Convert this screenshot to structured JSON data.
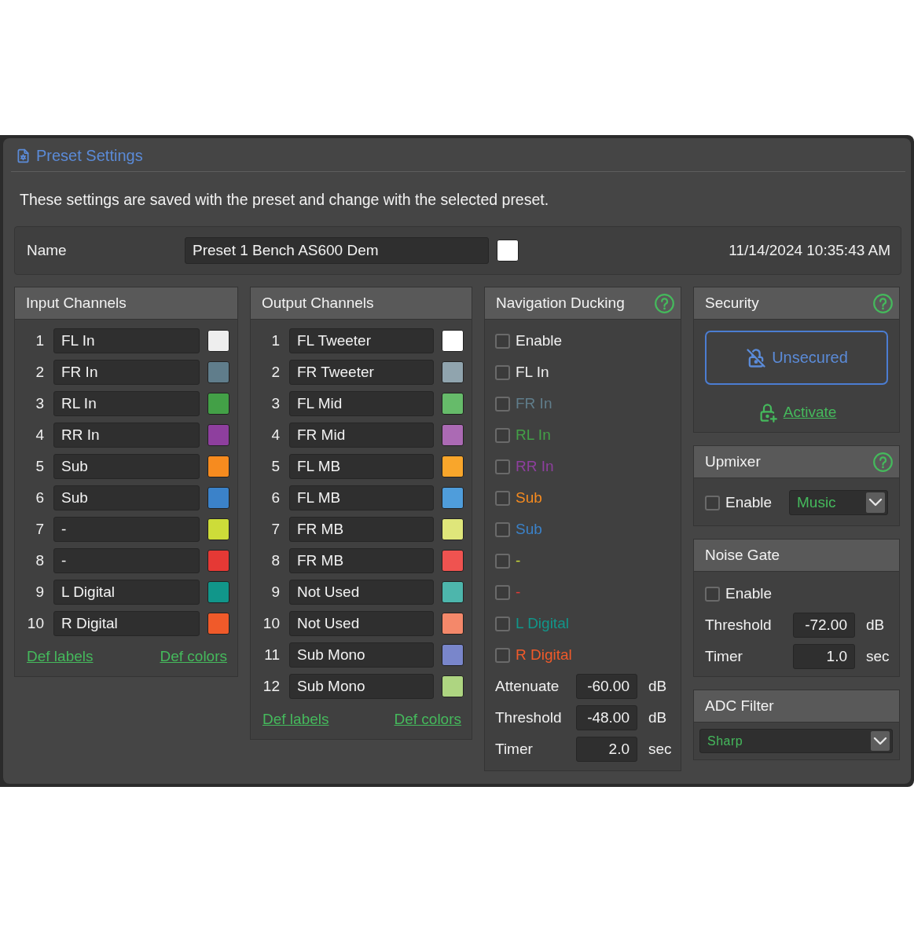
{
  "window": {
    "title": "Preset Settings"
  },
  "description": "These settings are saved with the preset and change with the selected preset.",
  "preset": {
    "label": "Name",
    "value": "Preset 1 Bench AS600 Dem",
    "color": "#ffffff",
    "timestamp": "11/14/2024 10:35:43 AM"
  },
  "input_channels": {
    "title": "Input Channels",
    "channels": [
      {
        "number": "1",
        "name": "FL In",
        "color": "#eeeeee"
      },
      {
        "number": "2",
        "name": "FR In",
        "color": "#607d8b"
      },
      {
        "number": "3",
        "name": "RL In",
        "color": "#43a047"
      },
      {
        "number": "4",
        "name": "RR In",
        "color": "#8e3f9e"
      },
      {
        "number": "5",
        "name": "Sub",
        "color": "#f68b1f"
      },
      {
        "number": "6",
        "name": "Sub",
        "color": "#3b82c9"
      },
      {
        "number": "7",
        "name": "-",
        "color": "#cddc39"
      },
      {
        "number": "8",
        "name": "-",
        "color": "#e53935"
      },
      {
        "number": "9",
        "name": "L Digital",
        "color": "#11968a"
      },
      {
        "number": "10",
        "name": "R Digital",
        "color": "#f05a2a"
      }
    ],
    "links": [
      "Def labels",
      "Def colors"
    ]
  },
  "output_channels": {
    "title": "Output Channels",
    "channels": [
      {
        "number": "1",
        "name": "FL Tweeter",
        "color": "#ffffff"
      },
      {
        "number": "2",
        "name": "FR Tweeter",
        "color": "#90a4ae"
      },
      {
        "number": "3",
        "name": "FL Mid",
        "color": "#66bb6a"
      },
      {
        "number": "4",
        "name": "FR Mid",
        "color": "#ab6ab4"
      },
      {
        "number": "5",
        "name": "FL MB",
        "color": "#f9a62b"
      },
      {
        "number": "6",
        "name": "FL MB",
        "color": "#4f9ddb"
      },
      {
        "number": "7",
        "name": "FR MB",
        "color": "#dfe67a"
      },
      {
        "number": "8",
        "name": "FR MB",
        "color": "#ef5350"
      },
      {
        "number": "9",
        "name": "Not Used",
        "color": "#4db6ac"
      },
      {
        "number": "10",
        "name": "Not Used",
        "color": "#f4886a"
      },
      {
        "number": "11",
        "name": "Sub Mono",
        "color": "#7986cb"
      },
      {
        "number": "12",
        "name": "Sub Mono",
        "color": "#aed581"
      }
    ],
    "links": [
      "Def labels",
      "Def colors"
    ]
  },
  "navigation_ducking": {
    "title": "Navigation Ducking",
    "help": true,
    "enable": {
      "label": "Enable",
      "checked": false
    },
    "channels": [
      {
        "label": "FL In",
        "checked": false,
        "color": "#eeeeee"
      },
      {
        "label": "FR In",
        "checked": false,
        "color": "#607d8b"
      },
      {
        "label": "RL In",
        "checked": false,
        "color": "#43a047"
      },
      {
        "label": "RR In",
        "checked": false,
        "color": "#8e3f9e"
      },
      {
        "label": "Sub",
        "checked": false,
        "color": "#f68b1f"
      },
      {
        "label": "Sub",
        "checked": false,
        "color": "#3b82c9"
      },
      {
        "label": "-",
        "checked": false,
        "color": "#cddc39"
      },
      {
        "label": "-",
        "checked": false,
        "color": "#e53935"
      },
      {
        "label": "L Digital",
        "checked": false,
        "color": "#11968a"
      },
      {
        "label": "R Digital",
        "checked": false,
        "color": "#f05a2a"
      }
    ],
    "params": [
      {
        "label": "Attenuate",
        "value": "-60.00",
        "unit": "dB"
      },
      {
        "label": "Threshold",
        "value": "-48.00",
        "unit": "dB"
      },
      {
        "label": "Timer",
        "value": "2.0",
        "unit": "sec"
      }
    ]
  },
  "security": {
    "title": "Security",
    "help": true,
    "status": "Unsecured",
    "action": "Activate"
  },
  "upmixer": {
    "title": "Upmixer",
    "help": true,
    "enable": {
      "label": "Enable",
      "checked": false
    },
    "mode": "Music"
  },
  "noise_gate": {
    "title": "Noise Gate",
    "enable": {
      "label": "Enable",
      "checked": false
    },
    "params": [
      {
        "label": "Threshold",
        "value": "-72.00",
        "unit": "dB"
      },
      {
        "label": "Timer",
        "value": "1.0",
        "unit": "sec"
      }
    ]
  },
  "adc_filter": {
    "title": "ADC Filter",
    "value": "Sharp"
  }
}
